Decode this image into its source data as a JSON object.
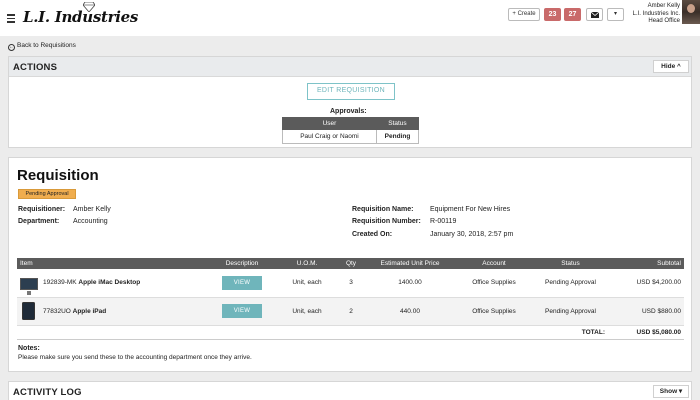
{
  "header": {
    "logo_text": "L.I. Industries",
    "create_label": "+ Create",
    "badge_one": "23",
    "badge_two": "27",
    "caret": "▾",
    "user_name": "Amber Kelly",
    "company": "L.I. Industries Inc.",
    "office": "Head Office"
  },
  "back_link": "Back to Requisitions",
  "actions": {
    "title": "ACTIONS",
    "hide_label": "Hide ^",
    "edit_label": "EDIT REQUISITION",
    "approvals_label": "Approvals:",
    "columns": [
      "User",
      "Status"
    ],
    "rows": [
      {
        "user": "Paul Craig or Naomi",
        "status": "Pending"
      }
    ]
  },
  "requisition": {
    "title": "Requisition",
    "status_badge": "Pending Approval",
    "requisitioner_label": "Requisitioner:",
    "requisitioner": "Amber Kelly",
    "department_label": "Department:",
    "department": "Accounting",
    "name_label": "Requisition Name:",
    "name": "Equipment For New Hires",
    "number_label": "Requisition Number:",
    "number": "R-00119",
    "created_label": "Created On:",
    "created": "January 30, 2018, 2:57 pm",
    "columns": [
      "Item",
      "Description",
      "U.O.M.",
      "Qty",
      "Estimated Unit Price",
      "Account",
      "Status",
      "Subtotal"
    ],
    "items": [
      {
        "sku": "192839-MK",
        "name": "Apple iMac Desktop",
        "view": "VIEW",
        "uom": "Unit, each",
        "qty": "3",
        "price": "1400.00",
        "account": "Office Supplies",
        "status": "Pending Approval",
        "subtotal": "USD $4,200.00"
      },
      {
        "sku": "77832UO",
        "name": "Apple iPad",
        "view": "VIEW",
        "uom": "Unit, each",
        "qty": "2",
        "price": "440.00",
        "account": "Office Supplies",
        "status": "Pending Approval",
        "subtotal": "USD $880.00"
      }
    ],
    "total_label": "TOTAL:",
    "total": "USD $5,080.00",
    "notes_label": "Notes:",
    "notes": "Please make sure you send these to the accounting department once they arrive."
  },
  "activity": {
    "title": "ACTIVITY LOG",
    "show_label": "Show ▾"
  }
}
